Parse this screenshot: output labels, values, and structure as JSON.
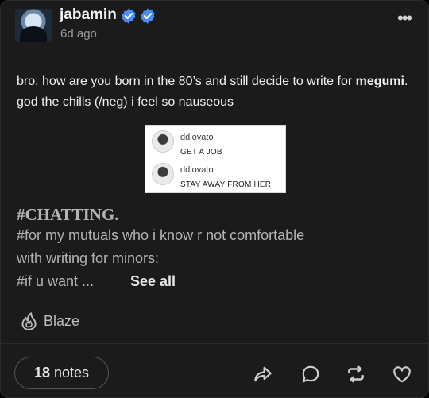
{
  "post": {
    "username": "jabamin",
    "time": "6d ago",
    "more_label": "•••",
    "text_before": "bro. how are you born in the 80’s and still decide to write for ",
    "text_bold": "megumi",
    "text_after": ". god the chills (/neg) i feel so nauseous"
  },
  "embedded_screenshot": {
    "comments": [
      {
        "name": "ddlovato",
        "message": "GET A JOB"
      },
      {
        "name": "ddlovato",
        "message": "STAY AWAY FROM HER"
      }
    ]
  },
  "tags": {
    "heading": "#CHATTING.",
    "line1": "#for my mutuals who i know r not comfortable",
    "line2": "with writing for minors:",
    "line3": "#if u want ...",
    "see_all": "See all"
  },
  "blaze": {
    "label": "Blaze"
  },
  "footer": {
    "notes_count": "18",
    "notes_label": "notes"
  },
  "colors": {
    "background": "#1b1b1b",
    "verified_blue": "#4a8cf7",
    "text": "#f2f2f2",
    "muted": "#9c9c9c"
  },
  "icons": [
    "verified-badge-icon",
    "more-icon",
    "flame-icon",
    "share-icon",
    "reply-icon",
    "reblog-icon",
    "like-icon"
  ]
}
